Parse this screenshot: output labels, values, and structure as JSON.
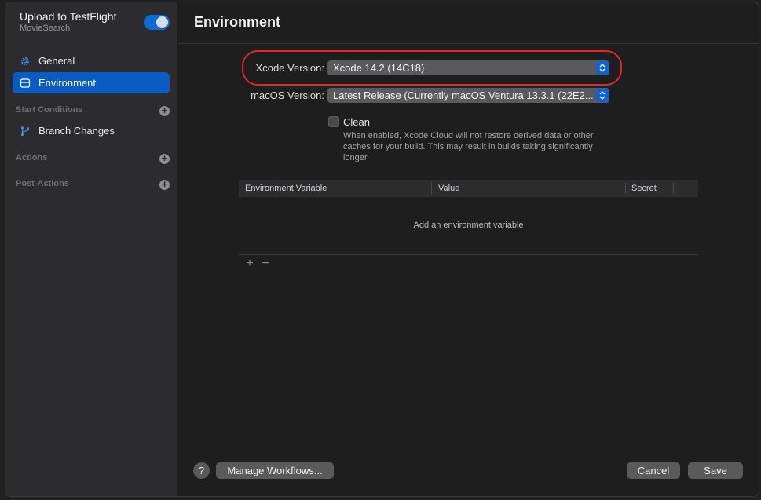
{
  "sidebar": {
    "workflow_title": "Upload to TestFlight",
    "workflow_subtitle": "MovieSearch",
    "toggle_on": true,
    "items": [
      {
        "label": "General",
        "icon": "gear-icon",
        "selected": false
      },
      {
        "label": "Environment",
        "icon": "environment-icon",
        "selected": true
      }
    ],
    "sections": {
      "start_conditions": "Start Conditions",
      "actions": "Actions",
      "post_actions": "Post-Actions"
    },
    "start_condition_items": [
      {
        "label": "Branch Changes",
        "icon": "branch-icon"
      }
    ]
  },
  "main": {
    "title": "Environment",
    "xcode_version": {
      "label": "Xcode Version:",
      "value": "Xcode 14.2 (14C18)"
    },
    "macos_version": {
      "label": "macOS Version:",
      "value": "Latest Release (Currently macOS Ventura 13.3.1 (22E2..."
    },
    "clean": {
      "label": "Clean",
      "checked": false,
      "description": "When enabled, Xcode Cloud will not restore derived data or other caches for your build. This may result in builds taking significantly longer."
    },
    "env_table": {
      "columns": [
        "Environment Variable",
        "Value",
        "Secret"
      ],
      "empty_message": "Add an environment variable",
      "add_symbol": "+",
      "remove_symbol": "−"
    }
  },
  "footer": {
    "help": "?",
    "manage_workflows": "Manage Workflows...",
    "cancel": "Cancel",
    "save": "Save"
  },
  "colors": {
    "accent": "#0a5bc4",
    "highlight_ring": "#e3262a"
  }
}
